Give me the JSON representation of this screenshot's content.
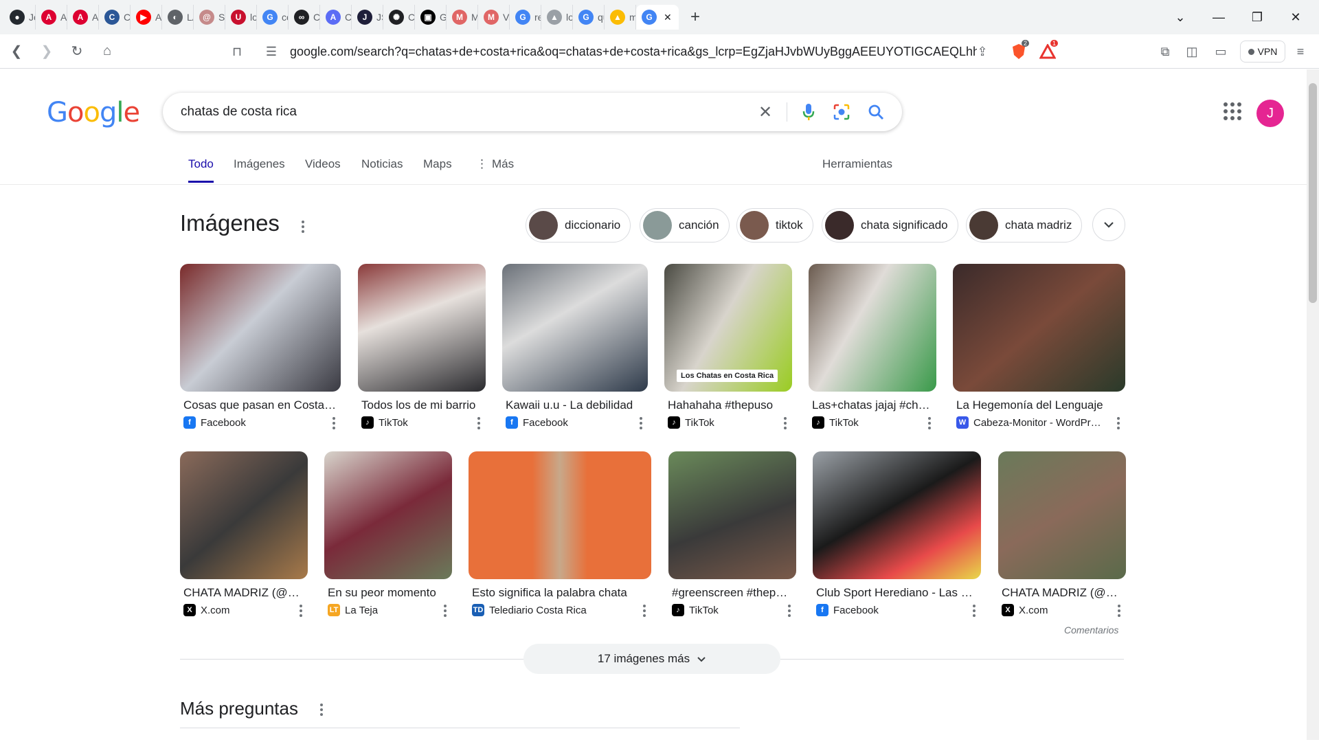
{
  "browser": {
    "tabs": [
      {
        "icon": "github-icon",
        "title": "Jos",
        "color": "#24292f",
        "glyph": "●"
      },
      {
        "icon": "angular-icon",
        "title": "An",
        "color": "#dd0031",
        "glyph": "A"
      },
      {
        "icon": "angular-icon",
        "title": "An",
        "color": "#dd0031",
        "glyph": "A"
      },
      {
        "icon": "cloud-icon",
        "title": "Clo",
        "color": "#2b5797",
        "glyph": "C"
      },
      {
        "icon": "youtube-icon",
        "title": "Ap",
        "color": "#ff0000",
        "glyph": "▶"
      },
      {
        "icon": "globe-icon",
        "title": "LA",
        "color": "#5f6368",
        "glyph": "◐"
      },
      {
        "icon": "swirl-icon",
        "title": "Sw",
        "color": "#c58a8a",
        "glyph": "@"
      },
      {
        "icon": "una-icon",
        "title": "loc",
        "color": "#c8102e",
        "glyph": "U"
      },
      {
        "icon": "google-icon",
        "title": "cor",
        "color": "#4285f4",
        "glyph": "G"
      },
      {
        "icon": "link-icon",
        "title": "Cre",
        "color": "#202124",
        "glyph": "∞"
      },
      {
        "icon": "azure-icon",
        "title": "Cu",
        "color": "#5b6cf5",
        "glyph": "A"
      },
      {
        "icon": "jscript-icon",
        "title": "JSC",
        "color": "#1f1f3a",
        "glyph": "J"
      },
      {
        "icon": "openai-icon",
        "title": "Cre",
        "color": "#202124",
        "glyph": "✺"
      },
      {
        "icon": "gallery-icon",
        "title": "Ga",
        "color": "#000000",
        "glyph": "▣"
      },
      {
        "icon": "mi-icon",
        "title": "Mi",
        "color": "#e06666",
        "glyph": "M"
      },
      {
        "icon": "mi-icon",
        "title": "Val",
        "color": "#e06666",
        "glyph": "M"
      },
      {
        "icon": "google-icon",
        "title": "rel",
        "color": "#4285f4",
        "glyph": "G"
      },
      {
        "icon": "mountain-icon",
        "title": "loc",
        "color": "#9aa0a6",
        "glyph": "▲"
      },
      {
        "icon": "google-icon",
        "title": "qu",
        "color": "#4285f4",
        "glyph": "G"
      },
      {
        "icon": "drive-icon",
        "title": "me",
        "color": "#fbbc04",
        "glyph": "▲"
      }
    ],
    "active_tab_glyph": "G",
    "url": "google.com/search?q=chatas+de+costa+rica&oq=chatas+de+costa+rica&gs_lcrp=EgZjaHJvbWUyBggAEEUYOTIGCAEQLhhA...",
    "vpn_label": "VPN",
    "shield_badge": "2",
    "alert_badge": "1"
  },
  "search": {
    "query": "chatas de costa rica",
    "tabs": [
      "Todo",
      "Imágenes",
      "Videos",
      "Noticias",
      "Maps",
      "Más"
    ],
    "tools_label": "Herramientas",
    "avatar_letter": "J"
  },
  "images": {
    "heading": "Imágenes",
    "chips": [
      {
        "label": "diccionario",
        "thumb": "#5a4a48"
      },
      {
        "label": "canción",
        "thumb": "#8a9a98"
      },
      {
        "label": "tiktok",
        "thumb": "#7a5a4e"
      },
      {
        "label": "chata significado",
        "thumb": "#3a2a2a"
      },
      {
        "label": "chata madriz",
        "thumb": "#4a3a34"
      }
    ],
    "row1": [
      {
        "caption": "Cosas que pasan en Costa Rica",
        "source": "Facebook",
        "src_icon": "facebook-icon",
        "src_color": "#1877f2",
        "src_glyph": "f",
        "img_bg": "linear-gradient(135deg,#7a2a2a,#c8ccd4 45%,#3a3a42)"
      },
      {
        "caption": "Todos los de mi barrio",
        "source": "TikTok",
        "src_icon": "tiktok-icon",
        "src_color": "#000000",
        "src_glyph": "♪",
        "img_bg": "linear-gradient(160deg,#8a3a3a,#e6e0dc 40%,#2a2a2e)"
      },
      {
        "caption": "Kawaii u.u - La debilidad",
        "source": "Facebook",
        "src_icon": "facebook-icon",
        "src_color": "#1877f2",
        "src_glyph": "f",
        "img_bg": "linear-gradient(150deg,#6a7078,#dcdcdc 40%,#2e3a4a)"
      },
      {
        "caption": "Hahahaha #thepuso",
        "source": "TikTok",
        "src_icon": "tiktok-icon",
        "src_color": "#000000",
        "src_glyph": "♪",
        "img_bg": "linear-gradient(120deg,#4a4a42,#d8d4cc 45%,#9acc22)"
      },
      {
        "caption": "Las+chatas jajaj #chatas",
        "source": "TikTok",
        "src_icon": "tiktok-icon",
        "src_color": "#000000",
        "src_glyph": "♪",
        "img_bg": "linear-gradient(120deg,#6a5a4e,#e0dcd8 40%,#3a9a4a)"
      },
      {
        "caption": "La Hegemonía del Lenguaje",
        "source": "Cabeza-Monitor - WordPress",
        "src_icon": "wordpress-icon",
        "src_color": "#3858e9",
        "src_glyph": "W",
        "img_bg": "linear-gradient(140deg,#3a2a2a,#7a4a3a 50%,#2a3a2a)"
      }
    ],
    "row1_overlay_text": "Los Chatas en Costa Rica",
    "row2": [
      {
        "caption": "CHATA MADRIZ (@chatamadriz)",
        "source": "X.com",
        "src_icon": "x-icon",
        "src_color": "#000000",
        "src_glyph": "X",
        "img_bg": "linear-gradient(140deg,#8a6a5a,#3a3a3a 50%,#a87a4a)"
      },
      {
        "caption": "En su peor momento",
        "source": "La Teja",
        "src_icon": "lateja-icon",
        "src_color": "#f5a623",
        "src_glyph": "LT",
        "img_bg": "linear-gradient(150deg,#d8d4cc,#7a2a3a 50%,#6a7a5a)"
      },
      {
        "caption": "Esto significa la palabra chata",
        "source": "Telediario Costa Rica",
        "src_icon": "telediario-icon",
        "src_color": "#1a5fb4",
        "src_glyph": "TD",
        "img_bg": "linear-gradient(90deg,#e8703a,#e8703a 35%,#c8a88a 50%,#e8703a 65%)"
      },
      {
        "caption": "#greenscreen #thepuso",
        "source": "TikTok",
        "src_icon": "tiktok-icon",
        "src_color": "#000000",
        "src_glyph": "♪",
        "img_bg": "linear-gradient(160deg,#6a8a5a,#3a3a3a 55%,#7a5a4a)"
      },
      {
        "caption": "Club Sport Herediano - Las chatas",
        "source": "Facebook",
        "src_icon": "facebook-icon",
        "src_color": "#1877f2",
        "src_glyph": "f",
        "img_bg": "linear-gradient(150deg,#9aa0a6,#1a1a1a 45%,#e84a4a 75%,#e8d84a)"
      },
      {
        "caption": "CHATA MADRIZ (@chatamadriz)",
        "source": "X.com",
        "src_icon": "x-icon",
        "src_color": "#000000",
        "src_glyph": "X",
        "img_bg": "linear-gradient(150deg,#6a7a5a,#8a6a5a 50%,#5a6a4a)"
      }
    ],
    "feedback_label": "Comentarios",
    "more_label": "17 imágenes más"
  },
  "paa": {
    "heading": "Más preguntas"
  }
}
